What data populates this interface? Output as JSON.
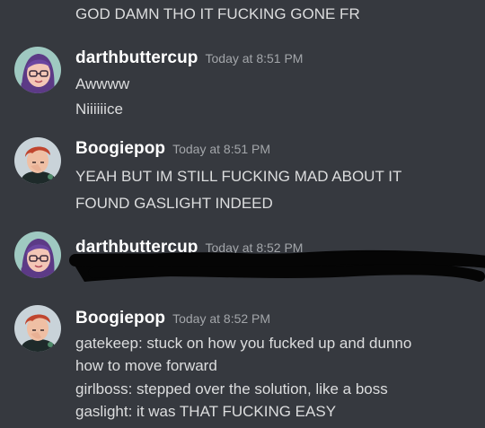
{
  "top_line": "GOD DAMN THO IT FUCKING GONE FR",
  "messages": [
    {
      "username": "darthbuttercup",
      "timestamp": "Today at 8:51 PM",
      "lines": [
        "Awwww",
        "Niiiiiice"
      ]
    },
    {
      "username": "Boogiepop",
      "timestamp": "Today at 8:51 PM",
      "lines": [
        "YEAH BUT IM STILL FUCKING MAD ABOUT IT",
        "FOUND GASLIGHT INDEED"
      ]
    },
    {
      "username": "darthbuttercup",
      "timestamp": "Today at 8:52 PM",
      "lines": []
    },
    {
      "username": "Boogiepop",
      "timestamp": "Today at 8:52 PM",
      "lines": [
        "gatekeep: stuck on how you fucked up and dunno",
        "how to move forward",
        "girlboss: stepped over the solution, like a boss",
        "gaslight: it was THAT FUCKING EASY"
      ]
    }
  ],
  "colors": {
    "background": "#36393f",
    "username": "#ffffff",
    "timestamp": "#a3a6aa",
    "text": "#dcddde"
  },
  "icons": {
    "avatar_darthbuttercup": "avatar-purple-hair-glasses",
    "avatar_boogiepop": "avatar-red-hair"
  }
}
